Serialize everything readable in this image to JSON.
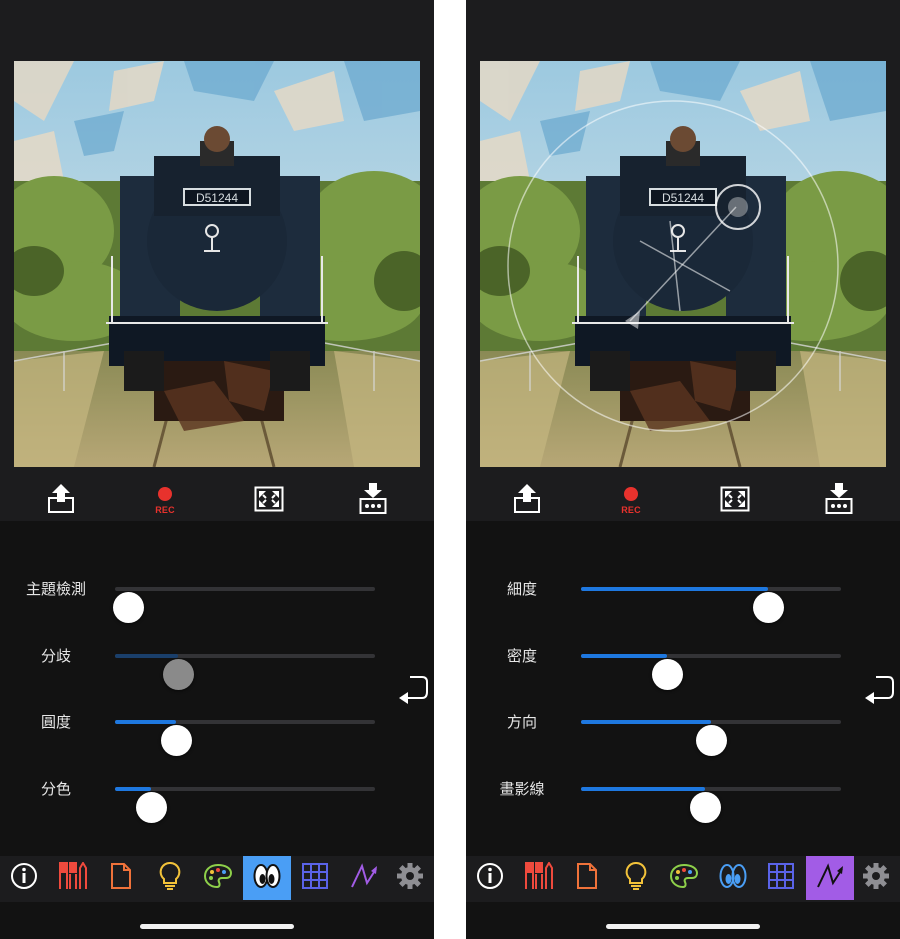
{
  "colors": {
    "accent_blue": "#1e78e0",
    "active_tab_blue": "#4a9ef5",
    "active_tab_purple": "#a25ce6",
    "rec_red": "#e8322d",
    "background": "#121212",
    "panel": "#1c1c1e"
  },
  "left_screen": {
    "toolbar": {
      "share_icon": "share-icon",
      "rec_label": "REC",
      "fullscreen_icon": "fullscreen-icon",
      "save_icon": "save-icon"
    },
    "sliders": [
      {
        "label": "主題檢測",
        "value": 0.05,
        "style": "knob-only"
      },
      {
        "label": "分歧",
        "value": 0.25,
        "style": "disabled"
      },
      {
        "label": "圓度",
        "value": 0.235,
        "style": "normal"
      },
      {
        "label": "分色",
        "value": 0.14,
        "style": "normal"
      }
    ],
    "undo_icon": "undo-icon",
    "active_tab": "eyes"
  },
  "right_screen": {
    "toolbar": {
      "share_icon": "share-icon",
      "rec_label": "REC",
      "fullscreen_icon": "fullscreen-icon",
      "save_icon": "save-icon"
    },
    "sliders": [
      {
        "label": "細度",
        "value": 0.72,
        "style": "normal"
      },
      {
        "label": "密度",
        "value": 0.33,
        "style": "normal"
      },
      {
        "label": "方向",
        "value": 0.5,
        "style": "normal"
      },
      {
        "label": "畫影線",
        "value": 0.475,
        "style": "normal"
      }
    ],
    "undo_icon": "undo-icon",
    "active_tab": "stroke"
  },
  "tabs": [
    {
      "id": "info",
      "icon": "info-icon"
    },
    {
      "id": "brushes",
      "icon": "brushes-icon"
    },
    {
      "id": "document",
      "icon": "document-icon"
    },
    {
      "id": "lightbulb",
      "icon": "lightbulb-icon"
    },
    {
      "id": "palette",
      "icon": "palette-icon"
    },
    {
      "id": "eyes",
      "icon": "eyes-icon"
    },
    {
      "id": "grid",
      "icon": "grid-icon"
    },
    {
      "id": "stroke",
      "icon": "stroke-direction-icon"
    },
    {
      "id": "settings",
      "icon": "gear-icon"
    }
  ]
}
